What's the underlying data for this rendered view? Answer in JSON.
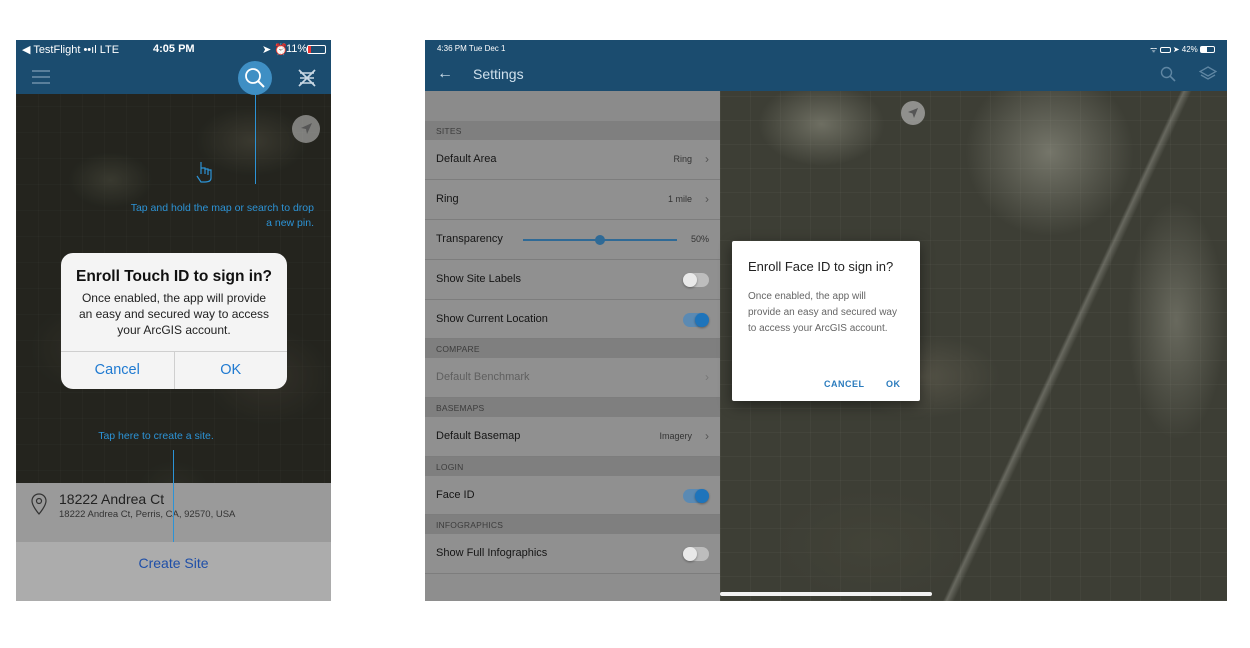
{
  "phone": {
    "status": {
      "carrier": "◀ TestFlight ••ıl LTE",
      "time": "4:05 PM",
      "battery": "11%"
    },
    "hints": {
      "drop_pin": "Tap and hold the map or search to drop a new pin.",
      "create_site": "Tap here to create a site."
    },
    "alert": {
      "title": "Enroll Touch ID to sign in?",
      "message": "Once enabled, the app will provide an easy and secured way to access your ArcGIS account.",
      "cancel": "Cancel",
      "ok": "OK"
    },
    "address": {
      "title": "18222 Andrea Ct",
      "subtitle": "18222 Andrea Ct, Perris, CA, 92570, USA"
    },
    "create_site": "Create Site"
  },
  "tablet": {
    "status": {
      "time": "4:36 PM  Tue Dec 1",
      "battery": "42%"
    },
    "header": {
      "title": "Settings"
    },
    "settings": {
      "sites_header": "SITES",
      "default_area": {
        "label": "Default Area",
        "value": "Ring"
      },
      "ring": {
        "label": "Ring",
        "value": "1 mile"
      },
      "transparency": {
        "label": "Transparency",
        "value": "50%",
        "level": 0.5
      },
      "show_site_labels": {
        "label": "Show Site Labels",
        "on": false
      },
      "show_current_location": {
        "label": "Show Current Location",
        "on": true
      },
      "compare_header": "COMPARE",
      "default_benchmark": {
        "label": "Default Benchmark"
      },
      "basemaps_header": "BASEMAPS",
      "default_basemap": {
        "label": "Default Basemap",
        "value": "Imagery"
      },
      "login_header": "LOGIN",
      "face_id": {
        "label": "Face ID",
        "on": true
      },
      "infographics_header": "INFOGRAPHICS",
      "show_full_infographics": {
        "label": "Show Full Infographics",
        "on": false
      }
    },
    "dialog": {
      "title": "Enroll Face ID to sign in?",
      "message": "Once enabled, the app will provide an easy and secured way to access your ArcGIS account.",
      "cancel": "CANCEL",
      "ok": "OK"
    }
  },
  "colors": {
    "nav": "#1b4c6f",
    "accent": "#2c93d6",
    "ios_link": "#1f7ad1",
    "toggle_on": "#1e74bb"
  }
}
